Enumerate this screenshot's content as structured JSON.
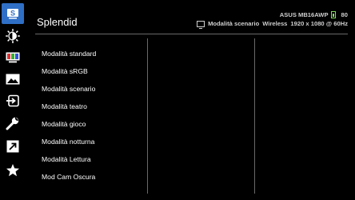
{
  "menu": {
    "title": "Splendid",
    "items": [
      "Modalità standard",
      "Modalità sRGB",
      "Modalità scenario",
      "Modalità teatro",
      "Modalità gioco",
      "Modalità notturna",
      "Modalità Lettura",
      "Mod Cam Oscura"
    ]
  },
  "status": {
    "model": "ASUS MB16AWP",
    "battery_level": "80",
    "mode": "Modalità scenario",
    "connection": "Wireless",
    "resolution": "1920 x 1080 @ 60Hz"
  },
  "sidebar": {
    "icons": [
      "splendid-icon",
      "brightness-icon",
      "color-icon",
      "image-icon",
      "input-select-icon",
      "system-setup-icon",
      "shortcut-icon",
      "favorite-icon"
    ],
    "active_color": "#2f6fc6"
  },
  "colors": {
    "background": "#000000",
    "text": "#ffffff",
    "battery": "#7fe05c"
  }
}
